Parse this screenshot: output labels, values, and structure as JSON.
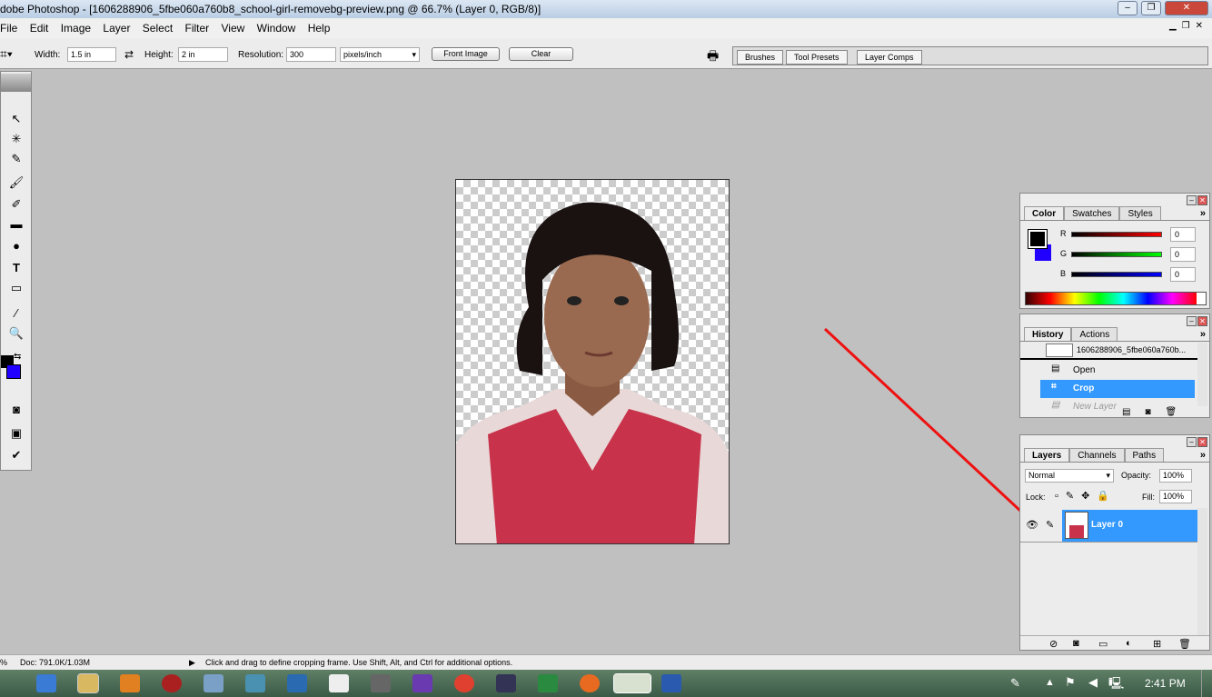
{
  "window": {
    "title": "dobe Photoshop - [1606288906_5fbe060a760b8_school-girl-removebg-preview.png @ 66.7% (Layer 0, RGB/8)]"
  },
  "menu": [
    "File",
    "Edit",
    "Image",
    "Layer",
    "Select",
    "Filter",
    "View",
    "Window",
    "Help"
  ],
  "options": {
    "width_label": "Width:",
    "width_value": "1.5 in",
    "height_label": "Height:",
    "height_value": "2 in",
    "resolution_label": "Resolution:",
    "resolution_value": "300",
    "unit": "pixels/inch",
    "front_image": "Front Image",
    "clear": "Clear"
  },
  "palette_tabs": [
    "Brushes",
    "Tool Presets",
    "Layer Comps"
  ],
  "color_panel": {
    "tabs": [
      "Color",
      "Swatches",
      "Styles"
    ],
    "channels": [
      {
        "label": "R",
        "value": "0"
      },
      {
        "label": "G",
        "value": "0"
      },
      {
        "label": "B",
        "value": "0"
      }
    ],
    "foreground": "#000000",
    "background": "#2200ff"
  },
  "history_panel": {
    "tabs": [
      "History",
      "Actions"
    ],
    "snapshot": "1606288906_5fbe060a760b...",
    "items": [
      "Open",
      "Crop",
      "New Layer"
    ],
    "active": "Crop"
  },
  "layers_panel": {
    "tabs": [
      "Layers",
      "Channels",
      "Paths"
    ],
    "blend_mode": "Normal",
    "opacity_label": "Opacity:",
    "opacity": "100%",
    "lock_label": "Lock:",
    "fill_label": "Fill:",
    "fill": "100%",
    "layers": [
      {
        "name": "Layer 0"
      }
    ]
  },
  "status": {
    "zoom": "%",
    "doc": "Doc: 791.0K/1.03M",
    "hint": "Click and drag to define cropping frame. Use Shift, Alt, and Ctrl for additional options."
  },
  "taskbar": {
    "time": "2:41 PM"
  },
  "accent": "#3399ff"
}
